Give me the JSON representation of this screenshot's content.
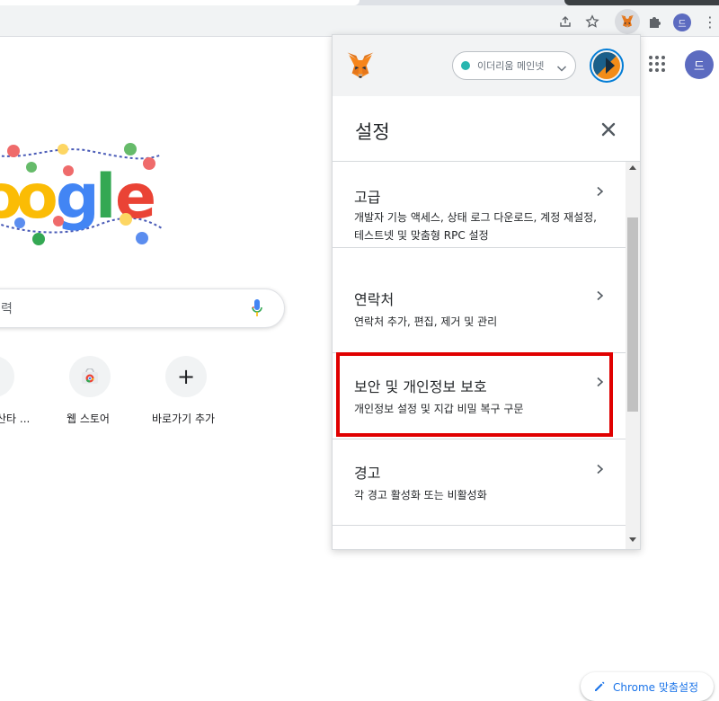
{
  "browser": {
    "profile_initial": "드",
    "icons": [
      "share-icon",
      "bookmark-star-icon",
      "metamask-extension-icon",
      "extensions-puzzle-icon",
      "profile-avatar",
      "chrome-menu-icon"
    ]
  },
  "google": {
    "search_placeholder_fragment": "력",
    "shortcuts": [
      {
        "label": "산타 ..."
      },
      {
        "label": "웹 스토어"
      },
      {
        "label": "바로가기 추가"
      }
    ],
    "profile_initial": "드",
    "customize_label": "Chrome 맞춤설정"
  },
  "metamask": {
    "network_label": "이더리움 메인넷",
    "network_color": "#29b6af",
    "settings_title": "설정",
    "items": [
      {
        "title": "고급",
        "description": "개발자 기능 액세스, 상태 로그 다운로드, 계정 재설정, 테스트넷 및 맞춤형 RPC 설정"
      },
      {
        "title": "연락처",
        "description": "연락처 추가, 편집, 제거 및 관리"
      },
      {
        "title": "보안 및 개인정보 보호",
        "description": "개인정보 설정 및 지갑 비밀 복구 구문",
        "highlighted": true
      },
      {
        "title": "경고",
        "description": "각 경고 활성화 또는 비활성화"
      }
    ],
    "highlight_color": "#e00000"
  }
}
